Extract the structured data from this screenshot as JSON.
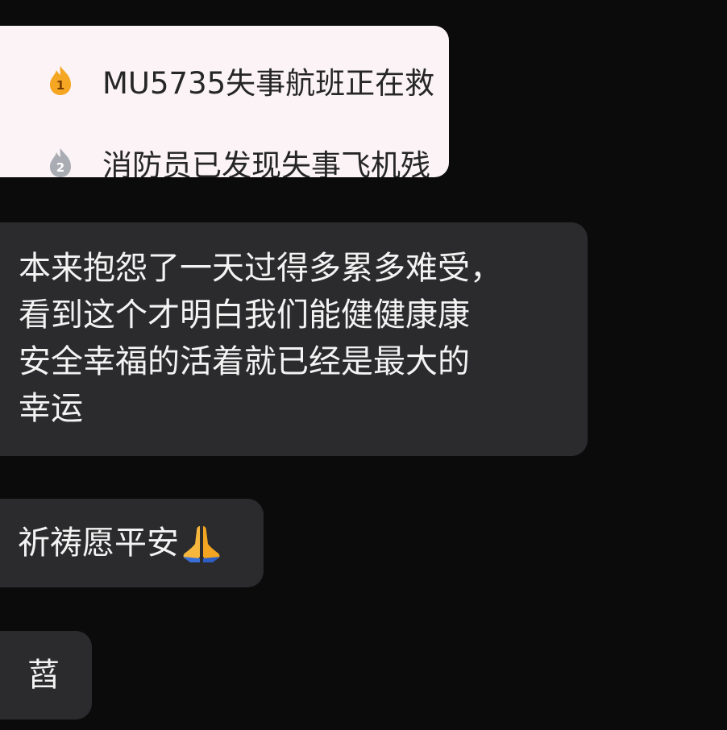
{
  "shared_card": {
    "items": [
      {
        "rank": "1",
        "text": "MU5735失事航班正在救",
        "badge_color": "#f5a623",
        "icon": "rank-flame-gold-icon"
      },
      {
        "rank": "2",
        "text": "消防员已发现失事飞机残",
        "badge_color": "#a9adb3",
        "icon": "rank-flame-silver-icon"
      }
    ]
  },
  "messages": [
    {
      "text": "本来抱怨了一天过得多累多难受，\n看到这个才明白我们能健健康康\n安全幸福的活着就已经是最大的\n幸运"
    },
    {
      "text": "祈祷愿平安",
      "emoji": "folded-hands-icon"
    },
    {
      "text": "蓞"
    }
  ],
  "colors": {
    "background": "#0b0b0c",
    "bubble": "#2b2b2d",
    "card": "#fbf3f6"
  }
}
